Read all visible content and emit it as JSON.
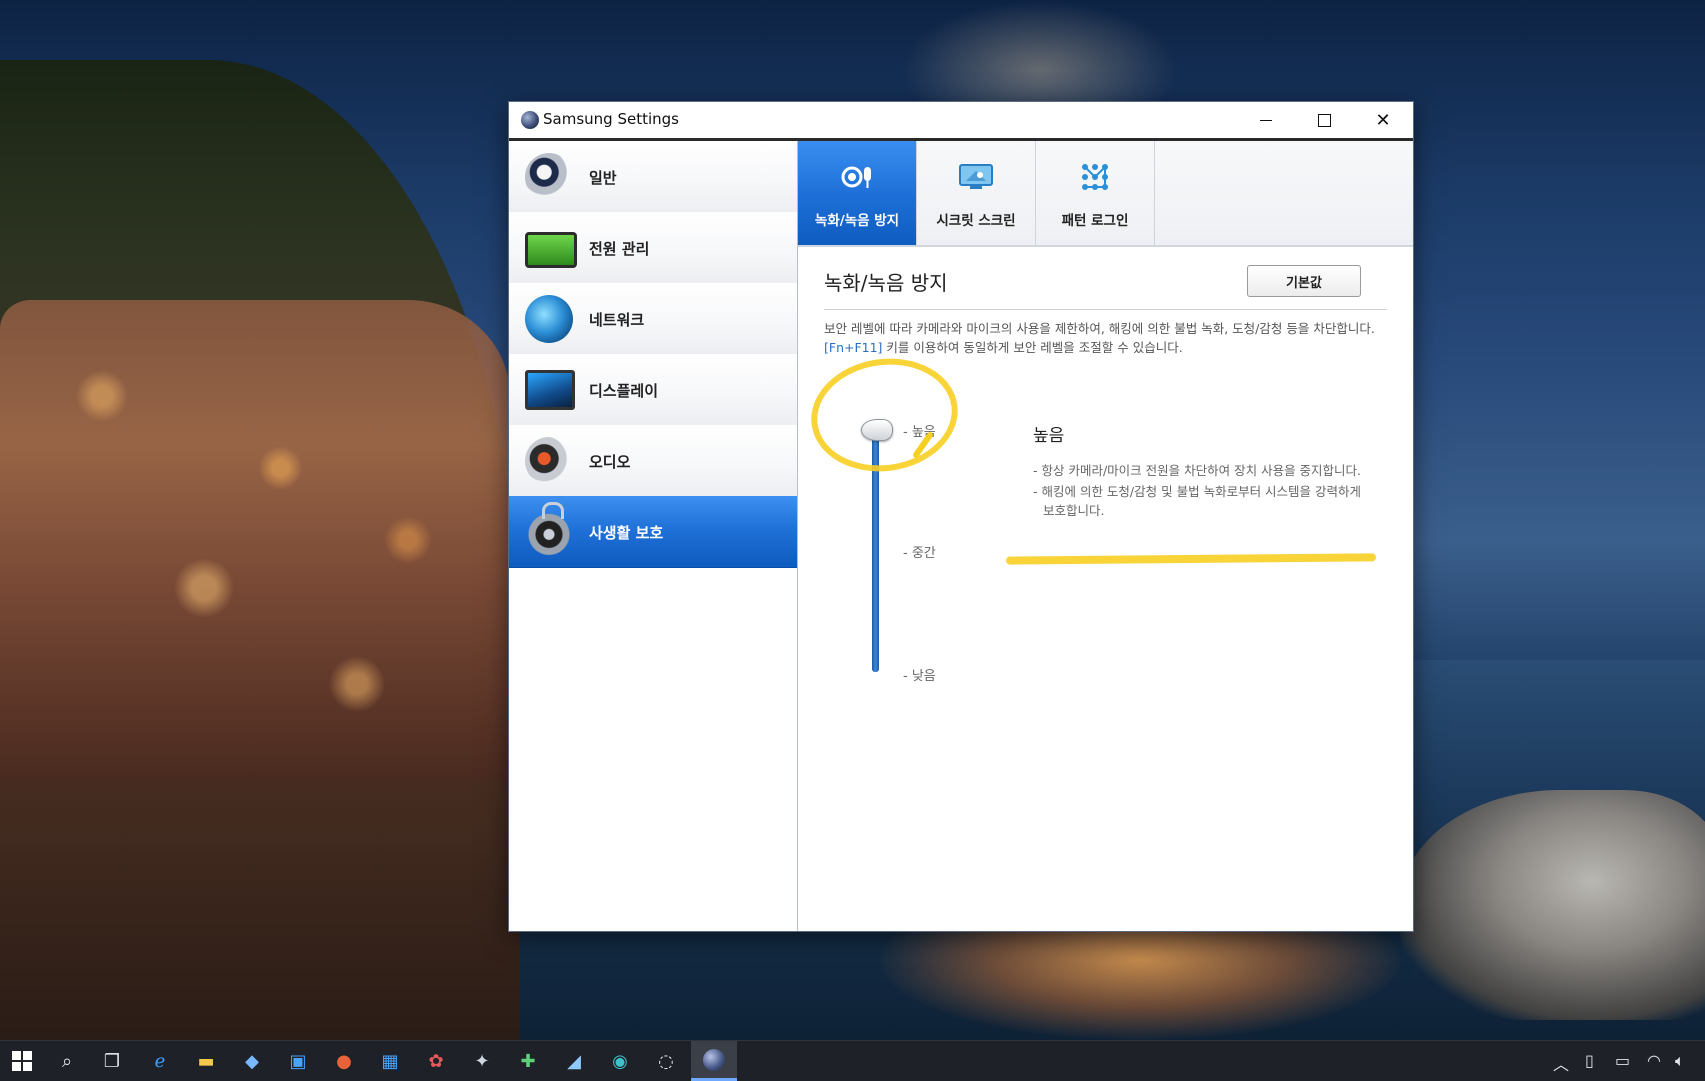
{
  "window": {
    "title": "Samsung Settings"
  },
  "sidebar": {
    "items": [
      {
        "label": "일반",
        "icon": "general-icon"
      },
      {
        "label": "전원 관리",
        "icon": "battery-icon"
      },
      {
        "label": "네트워크",
        "icon": "globe-wifi-icon"
      },
      {
        "label": "디스플레이",
        "icon": "monitor-icon"
      },
      {
        "label": "오디오",
        "icon": "speaker-icon"
      },
      {
        "label": "사생활 보호",
        "icon": "lock-icon",
        "active": true
      }
    ]
  },
  "tabs": [
    {
      "label": "녹화/녹음 방지",
      "icon": "camera-mic-icon",
      "active": true
    },
    {
      "label": "시크릿 스크린",
      "icon": "secret-screen-icon"
    },
    {
      "label": "패턴 로그인",
      "icon": "pattern-grid-icon"
    }
  ],
  "content": {
    "title": "녹화/녹음 방지",
    "reset_label": "기본값",
    "description_before": "보안 레벨에 따라 카메라와 마이크의 사용을 제한하여, 해킹에 의한 불법 녹화, 도청/감청 등을 차단합니다. ",
    "hotkey": "[Fn+F11]",
    "description_after": " 키를 이용하여 동일하게 보안 레벨을 조절할 수 있습니다.",
    "levels": {
      "high": "- 높음",
      "mid": "- 중간",
      "low": "- 낮음"
    },
    "selected_level": "high",
    "selected_title": "높음",
    "selected_desc": [
      "- 항상 카메라/마이크 전원을 차단하여 장치 사용을 중지합니다.",
      "- 해킹에 의한 도청/감청 및 불법 녹화로부터 시스템을 강력하게 보호합니다."
    ]
  },
  "colors": {
    "accent": "#1c6ed6",
    "annotation": "#f7cf22"
  }
}
